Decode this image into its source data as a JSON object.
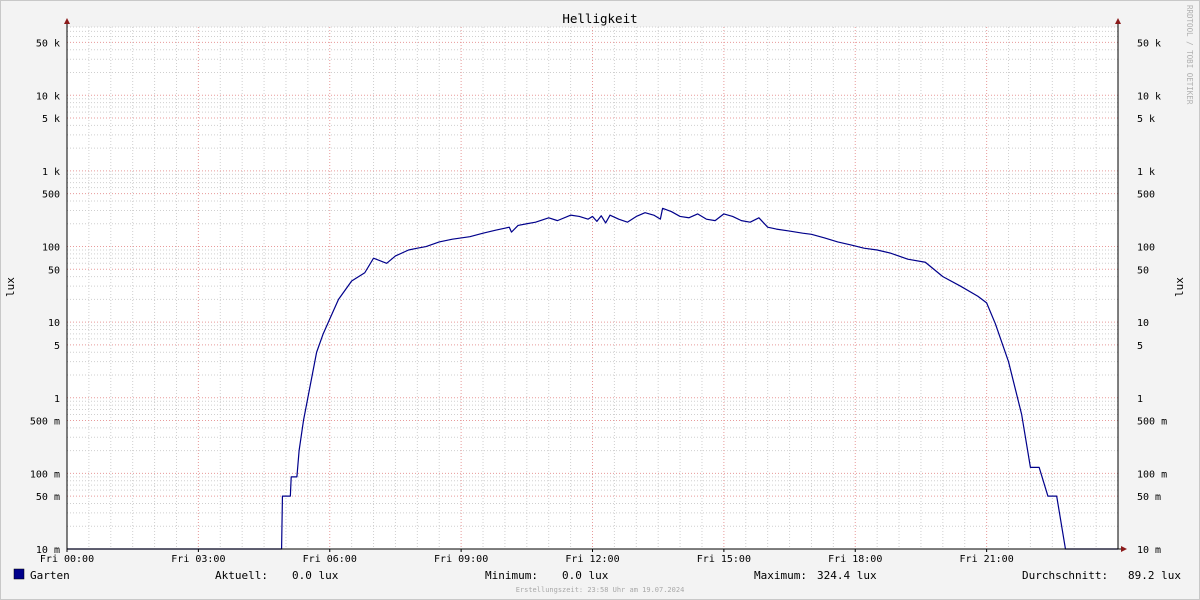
{
  "chart_data": {
    "type": "line",
    "title": "Helligkeit",
    "ylabel": "lux",
    "watermark": "RRDTOOL / TOBI OETIKER",
    "y_scale": "log",
    "ylim": [
      0.01,
      80000
    ],
    "xlim_hours": [
      0,
      24
    ],
    "grid": true,
    "colors": {
      "line": "#00008b",
      "major_grid": "#e89a9a",
      "minor_grid": "#cfcfcf",
      "axis_arrow": "#8b1a1a",
      "background": "#f3f3f3",
      "plot_background": "#ffffff"
    },
    "x_ticks": [
      {
        "hour": 0,
        "label": "Fri 00:00"
      },
      {
        "hour": 3,
        "label": "Fri 03:00"
      },
      {
        "hour": 6,
        "label": "Fri 06:00"
      },
      {
        "hour": 9,
        "label": "Fri 09:00"
      },
      {
        "hour": 12,
        "label": "Fri 12:00"
      },
      {
        "hour": 15,
        "label": "Fri 15:00"
      },
      {
        "hour": 18,
        "label": "Fri 18:00"
      },
      {
        "hour": 21,
        "label": "Fri 21:00"
      }
    ],
    "y_ticks": [
      {
        "value": 0.01,
        "label": "10 m"
      },
      {
        "value": 0.05,
        "label": "50 m"
      },
      {
        "value": 0.1,
        "label": "100 m"
      },
      {
        "value": 0.5,
        "label": "500 m"
      },
      {
        "value": 1,
        "label": "1"
      },
      {
        "value": 5,
        "label": "5"
      },
      {
        "value": 10,
        "label": "10"
      },
      {
        "value": 50,
        "label": "50"
      },
      {
        "value": 100,
        "label": "100"
      },
      {
        "value": 500,
        "label": "500"
      },
      {
        "value": 1000,
        "label": "1 k"
      },
      {
        "value": 5000,
        "label": "5 k"
      },
      {
        "value": 10000,
        "label": "10 k"
      },
      {
        "value": 50000,
        "label": "50 k"
      }
    ],
    "series": [
      {
        "name": "Garten",
        "color": "#00008b",
        "x": [
          0,
          4.9,
          4.92,
          5.1,
          5.12,
          5.25,
          5.3,
          5.4,
          5.5,
          5.6,
          5.7,
          5.85,
          6.0,
          6.2,
          6.5,
          6.8,
          7.0,
          7.3,
          7.5,
          7.8,
          8.0,
          8.2,
          8.5,
          8.8,
          9.0,
          9.2,
          9.5,
          9.8,
          10.0,
          10.1,
          10.15,
          10.3,
          10.5,
          10.7,
          11.0,
          11.2,
          11.5,
          11.7,
          11.9,
          12.0,
          12.1,
          12.2,
          12.3,
          12.4,
          12.6,
          12.8,
          13.0,
          13.2,
          13.4,
          13.55,
          13.6,
          13.8,
          14.0,
          14.2,
          14.4,
          14.6,
          14.8,
          15.0,
          15.2,
          15.4,
          15.6,
          15.8,
          16.0,
          16.2,
          16.5,
          16.8,
          17.0,
          17.3,
          17.6,
          17.9,
          18.2,
          18.5,
          18.8,
          19.2,
          19.6,
          20.0,
          20.4,
          20.8,
          21.0,
          21.2,
          21.5,
          21.8,
          22.0,
          22.2,
          22.4,
          22.6,
          22.8,
          22.9,
          22.95,
          23.0,
          23.05,
          23.3,
          24.0
        ],
        "values": [
          0.01,
          0.01,
          0.05,
          0.05,
          0.09,
          0.09,
          0.2,
          0.5,
          1.0,
          2.0,
          4.0,
          7.0,
          11,
          20,
          35,
          45,
          70,
          60,
          75,
          90,
          95,
          100,
          115,
          125,
          130,
          135,
          150,
          165,
          175,
          180,
          155,
          190,
          200,
          210,
          240,
          220,
          260,
          250,
          230,
          250,
          215,
          255,
          205,
          260,
          230,
          210,
          250,
          280,
          260,
          230,
          320,
          290,
          250,
          240,
          270,
          230,
          220,
          270,
          250,
          220,
          210,
          240,
          180,
          170,
          160,
          150,
          145,
          130,
          115,
          105,
          95,
          90,
          82,
          68,
          62,
          40,
          30,
          22,
          18,
          9.5,
          3.0,
          0.6,
          0.12,
          0.12,
          0.05,
          0.05,
          0.01,
          0.01,
          0.01,
          0.01,
          0.01,
          0.01,
          0.01
        ]
      }
    ]
  },
  "legend": {
    "series_name": "Garten",
    "current_label": "Aktuell:",
    "current_value": "0.0 lux",
    "min_label": "Minimum:",
    "min_value": "0.0 lux",
    "max_label": "Maximum:",
    "max_value": "324.4 lux",
    "avg_label": "Durchschnitt:",
    "avg_value": "89.2 lux"
  },
  "footer": {
    "created": "Erstellungszeit: 23:58 Uhr am 19.07.2024"
  }
}
